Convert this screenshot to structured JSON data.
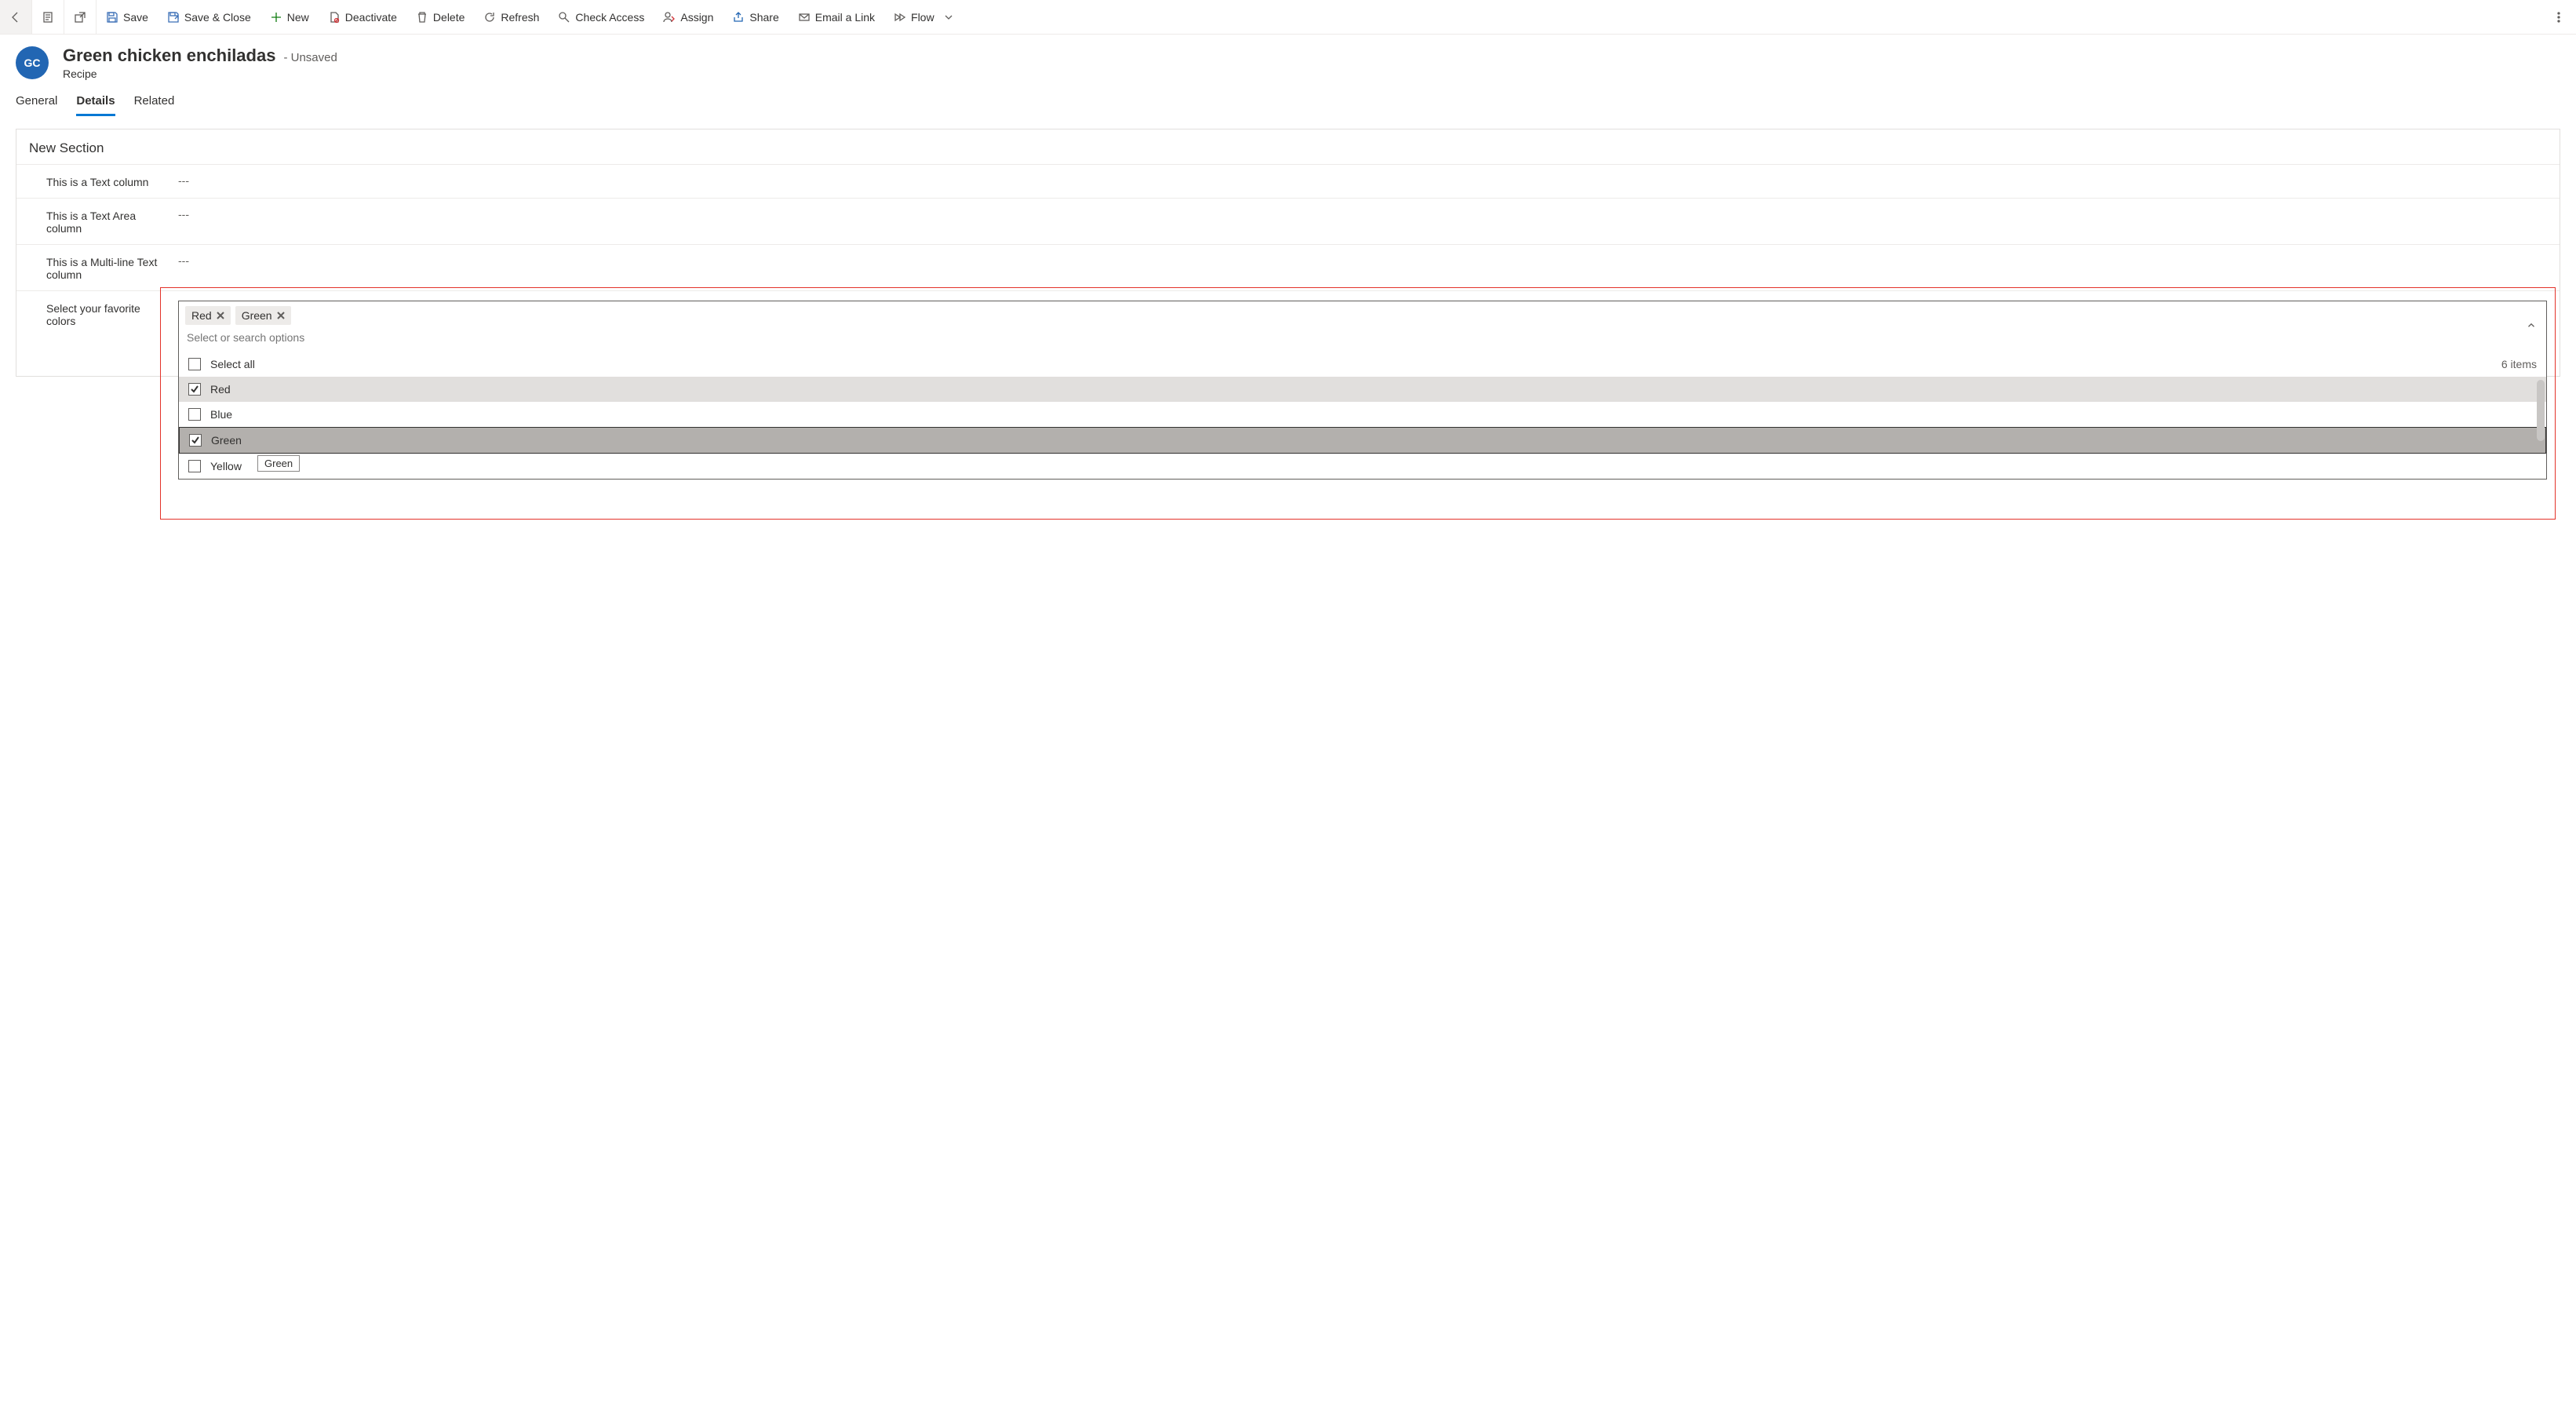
{
  "commands": {
    "save": "Save",
    "save_close": "Save & Close",
    "new": "New",
    "deactivate": "Deactivate",
    "delete": "Delete",
    "refresh": "Refresh",
    "check_access": "Check Access",
    "assign": "Assign",
    "share": "Share",
    "email_link": "Email a Link",
    "flow": "Flow"
  },
  "header": {
    "avatar_initials": "GC",
    "title": "Green chicken enchiladas",
    "status": "- Unsaved",
    "subtitle": "Recipe"
  },
  "tabs": {
    "general": "General",
    "details": "Details",
    "related": "Related"
  },
  "section": {
    "title": "New Section",
    "fields": {
      "text_col_label": "This is a Text column",
      "text_col_value": "---",
      "textarea_col_label": "This is a Text Area column",
      "textarea_col_value": "---",
      "multiline_col_label": "This is a Multi-line Text column",
      "multiline_col_value": "---",
      "colors_label": "Select your favorite colors"
    }
  },
  "multiselect": {
    "chips": {
      "red": "Red",
      "green": "Green"
    },
    "placeholder": "Select or search options",
    "select_all": "Select all",
    "count_text": "6 items",
    "options": {
      "red": {
        "label": "Red",
        "checked": true,
        "state": "selected"
      },
      "blue": {
        "label": "Blue",
        "checked": false,
        "state": ""
      },
      "green": {
        "label": "Green",
        "checked": true,
        "state": "active"
      },
      "yellow": {
        "label": "Yellow",
        "checked": false,
        "state": ""
      }
    },
    "tooltip": "Green",
    "total_items": 6
  }
}
